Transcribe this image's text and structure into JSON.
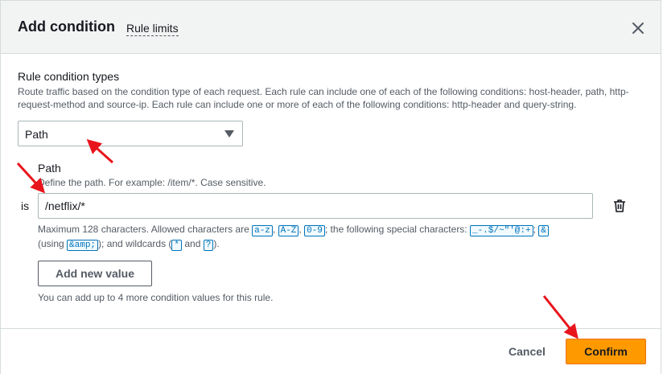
{
  "dialog": {
    "title": "Add condition",
    "rule_limits_link": "Rule limits"
  },
  "rule_condition": {
    "label": "Rule condition types",
    "description": "Route traffic based on the condition type of each request. Each rule can include one of each of the following conditions: host-header, path, http-request-method and source-ip. Each rule can include one or more of each of the following conditions: http-header and query-string.",
    "selected_type": "Path"
  },
  "path": {
    "label": "Path",
    "description": "Define the path. For example: /item/*. Case sensitive.",
    "operator": "is",
    "value": "/netflix/*",
    "constraint": {
      "text_1": "Maximum 128 characters. Allowed characters are ",
      "token_az": "a-z",
      "sep_1": ", ",
      "token_AZ": "A-Z",
      "sep_2": ", ",
      "token_09": "0-9",
      "text_2": "; the following special characters: ",
      "token_special": "_-.$/~\"'@:+",
      "sep_3": "; ",
      "token_amp": "&",
      "text_3": " (using ",
      "token_amp_escaped": "&amp;",
      "text_4": "); and wildcards (",
      "token_star": "*",
      "text_5": " and ",
      "token_question": "?",
      "text_6": ")."
    },
    "add_value_label": "Add new value",
    "add_value_hint": "You can add up to 4 more condition values for this rule."
  },
  "footer": {
    "cancel_label": "Cancel",
    "confirm_label": "Confirm"
  },
  "icons": {
    "close": "close-icon",
    "caret": "caret-down-icon",
    "trash": "trash-icon",
    "annotation_arrow": "red-arrow"
  },
  "colors": {
    "primary_button": "#ff9900",
    "link_token": "#0073bb",
    "annotation": "#e8141b"
  }
}
